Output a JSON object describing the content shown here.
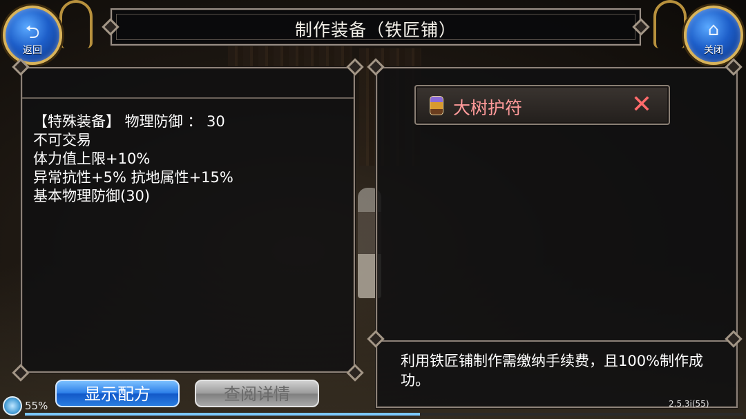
{
  "window": {
    "title": "制作装备（铁匠铺）"
  },
  "nav": {
    "back_label": "返回",
    "close_label": "关闭",
    "back_icon": "return-arrow-icon",
    "close_icon": "home-icon"
  },
  "item_stats": {
    "lines": [
      "【特殊装备】 物理防御 ： 30",
      "不可交易",
      "体力值上限+10%",
      "异常抗性+5% 抗地属性+15%",
      "基本物理防御(30)"
    ]
  },
  "selected_item": {
    "name": "大树护符",
    "icon": "amulet-icon",
    "remove_icon": "close-x-icon",
    "name_color": "#ff9a9a"
  },
  "notice": "利用铁匠铺制作需缴纳手续费，且100%制作成功。",
  "buttons": {
    "show_recipe": "显示配方",
    "view_details": "查阅详情"
  },
  "status": {
    "percent": "55%",
    "progress": 0.55,
    "version": "2.5.3i(55)"
  },
  "colors": {
    "accent_blue": "#2d7fe8",
    "disabled_gray": "#9a9a9a",
    "gold_trim": "#d8b35a"
  }
}
